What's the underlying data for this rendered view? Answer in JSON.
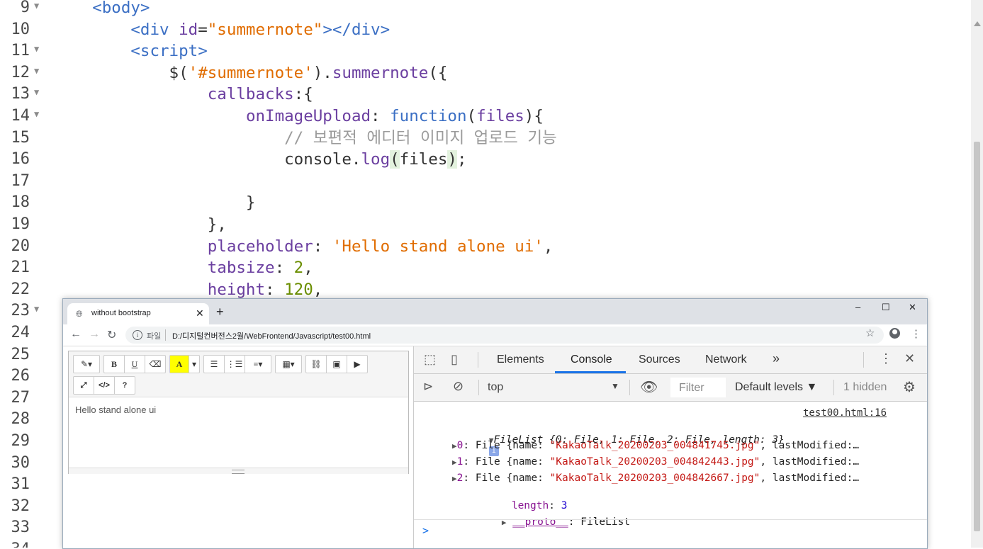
{
  "editor": {
    "lines": [
      {
        "n": "9",
        "fold": true,
        "parts": [
          {
            "t": "    ",
            "c": "t-plain"
          },
          {
            "t": "<body>",
            "c": "t-tag"
          }
        ]
      },
      {
        "n": "10",
        "fold": false,
        "parts": [
          {
            "t": "        ",
            "c": "t-plain"
          },
          {
            "t": "<div ",
            "c": "t-tag"
          },
          {
            "t": "id",
            "c": "t-attr"
          },
          {
            "t": "=",
            "c": "t-plain"
          },
          {
            "t": "\"summernote\"",
            "c": "t-str"
          },
          {
            "t": "></div>",
            "c": "t-tag"
          }
        ]
      },
      {
        "n": "11",
        "fold": true,
        "parts": [
          {
            "t": "        ",
            "c": "t-plain"
          },
          {
            "t": "<script>",
            "c": "t-tag"
          }
        ]
      },
      {
        "n": "12",
        "fold": true,
        "parts": [
          {
            "t": "            $(",
            "c": "t-plain"
          },
          {
            "t": "'#summernote'",
            "c": "t-str"
          },
          {
            "t": ").",
            "c": "t-plain"
          },
          {
            "t": "summernote",
            "c": "t-fn"
          },
          {
            "t": "({",
            "c": "t-plain"
          }
        ]
      },
      {
        "n": "13",
        "fold": true,
        "parts": [
          {
            "t": "                ",
            "c": "t-plain"
          },
          {
            "t": "callbacks",
            "c": "t-attr"
          },
          {
            "t": ":{",
            "c": "t-plain"
          }
        ]
      },
      {
        "n": "14",
        "fold": true,
        "parts": [
          {
            "t": "                    ",
            "c": "t-plain"
          },
          {
            "t": "onImageUpload",
            "c": "t-attr"
          },
          {
            "t": ": ",
            "c": "t-plain"
          },
          {
            "t": "function",
            "c": "t-kw"
          },
          {
            "t": "(",
            "c": "t-plain"
          },
          {
            "t": "files",
            "c": "t-attr"
          },
          {
            "t": "){",
            "c": "t-plain"
          }
        ]
      },
      {
        "n": "15",
        "fold": false,
        "parts": [
          {
            "t": "                        ",
            "c": "t-plain"
          },
          {
            "t": "// 보편적 에디터 이미지 업로드 기능",
            "c": "t-cm"
          }
        ]
      },
      {
        "n": "16",
        "fold": false,
        "parts": [
          {
            "t": "                        console.",
            "c": "t-plain"
          },
          {
            "t": "log",
            "c": "t-fn"
          },
          {
            "t": "(",
            "c": "t-plain hl"
          },
          {
            "t": "files",
            "c": "t-plain"
          },
          {
            "t": ")",
            "c": "t-plain hl"
          },
          {
            "t": ";",
            "c": "t-plain"
          }
        ]
      },
      {
        "n": "17",
        "fold": false,
        "parts": []
      },
      {
        "n": "18",
        "fold": false,
        "parts": [
          {
            "t": "                    }",
            "c": "t-plain"
          }
        ]
      },
      {
        "n": "19",
        "fold": false,
        "parts": [
          {
            "t": "                },",
            "c": "t-plain"
          }
        ]
      },
      {
        "n": "20",
        "fold": false,
        "parts": [
          {
            "t": "                ",
            "c": "t-plain"
          },
          {
            "t": "placeholder",
            "c": "t-attr"
          },
          {
            "t": ": ",
            "c": "t-plain"
          },
          {
            "t": "'Hello stand alone ui'",
            "c": "t-str"
          },
          {
            "t": ",",
            "c": "t-plain"
          }
        ]
      },
      {
        "n": "21",
        "fold": false,
        "parts": [
          {
            "t": "                ",
            "c": "t-plain"
          },
          {
            "t": "tabsize",
            "c": "t-attr"
          },
          {
            "t": ": ",
            "c": "t-plain"
          },
          {
            "t": "2",
            "c": "t-num"
          },
          {
            "t": ",",
            "c": "t-plain"
          }
        ]
      },
      {
        "n": "22",
        "fold": false,
        "parts": [
          {
            "t": "                ",
            "c": "t-plain"
          },
          {
            "t": "height",
            "c": "t-attr"
          },
          {
            "t": ": ",
            "c": "t-plain"
          },
          {
            "t": "120",
            "c": "t-num"
          },
          {
            "t": ",",
            "c": "t-plain"
          }
        ]
      },
      {
        "n": "23",
        "fold": true,
        "parts": []
      },
      {
        "n": "24",
        "fold": false,
        "parts": []
      },
      {
        "n": "25",
        "fold": false,
        "parts": []
      },
      {
        "n": "26",
        "fold": false,
        "parts": []
      },
      {
        "n": "27",
        "fold": false,
        "parts": []
      },
      {
        "n": "28",
        "fold": false,
        "parts": []
      },
      {
        "n": "29",
        "fold": false,
        "parts": []
      },
      {
        "n": "30",
        "fold": false,
        "parts": []
      },
      {
        "n": "31",
        "fold": false,
        "parts": []
      },
      {
        "n": "32",
        "fold": false,
        "parts": []
      },
      {
        "n": "33",
        "fold": false,
        "parts": []
      },
      {
        "n": "34",
        "fold": false,
        "parts": []
      }
    ]
  },
  "browser": {
    "tab_title": "without bootstrap",
    "tab_close": "✕",
    "new_tab": "+",
    "minimize": "–",
    "maximize": "☐",
    "close": "✕",
    "file_label": "파일",
    "url": "D:/디지털컨버전스2월/WebFrontend/Javascript/test00.html"
  },
  "summernote": {
    "toolbar_row1": [
      {
        "name": "magic-style-button",
        "label": "✎▾",
        "w": 36
      },
      {
        "name": "bold-button",
        "label": "B",
        "w": 28
      },
      {
        "name": "underline-button",
        "label": "U",
        "w": 28
      },
      {
        "name": "clear-format-button",
        "label": "⌫",
        "w": 28
      },
      {
        "name": "font-color-button",
        "label": "A",
        "w": 26
      },
      {
        "name": "font-color-dropdown-button",
        "label": "▾",
        "w": 14
      },
      {
        "name": "unordered-list-button",
        "label": "☰",
        "w": 28
      },
      {
        "name": "ordered-list-button",
        "label": "⋮☰",
        "w": 28
      },
      {
        "name": "paragraph-align-button",
        "label": "≡▾",
        "w": 36
      },
      {
        "name": "table-button",
        "label": "▦▾",
        "w": 36
      },
      {
        "name": "link-button",
        "label": "⛓",
        "w": 28
      },
      {
        "name": "image-button",
        "label": "▣",
        "w": 28
      },
      {
        "name": "video-button",
        "label": "▶",
        "w": 28
      }
    ],
    "toolbar_row2": [
      {
        "name": "fullscreen-button",
        "label": "⤢",
        "w": 28
      },
      {
        "name": "code-view-button",
        "label": "</>",
        "w": 28
      },
      {
        "name": "help-button",
        "label": "?",
        "w": 28
      }
    ],
    "placeholder": "Hello stand alone ui"
  },
  "devtools": {
    "tabs": [
      "Elements",
      "Console",
      "Sources",
      "Network"
    ],
    "more_tabs": "»",
    "context": "top",
    "filter_placeholder": "Filter",
    "levels": "Default levels ▼",
    "hidden": "1 hidden",
    "source_link": "test00.html:16",
    "filelist_label": "FileList",
    "filelist_preview": " {0: File, 1: File, 2: File, length: 3}",
    "files": [
      {
        "index": "0",
        "name": "\"KakaoTalk_20200203_004841745.jpg\"",
        "rest": ", lastModified:…"
      },
      {
        "index": "1",
        "name": "\"KakaoTalk_20200203_004842443.jpg\"",
        "rest": ", lastModified:…"
      },
      {
        "index": "2",
        "name": "\"KakaoTalk_20200203_004842667.jpg\"",
        "rest": ", lastModified:…"
      }
    ],
    "file_prefix": ": File {name: ",
    "length_key": "length",
    "length_val": "3",
    "proto_key": "__proto__",
    "proto_val": ": FileList",
    "prompt": ">"
  }
}
